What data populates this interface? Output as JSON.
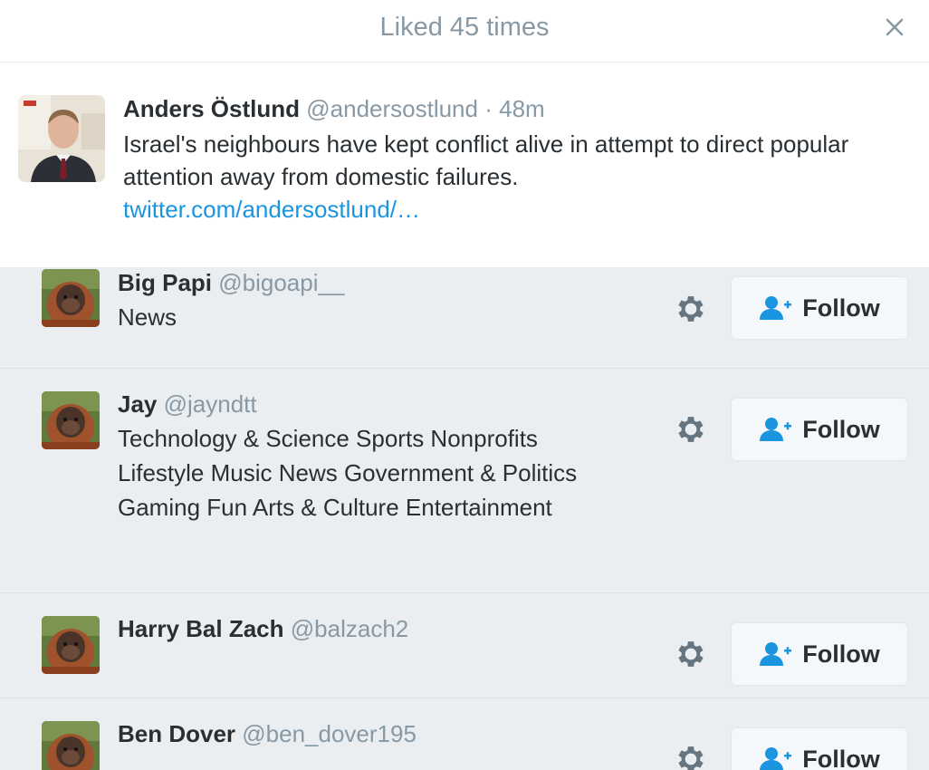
{
  "modal": {
    "title": "Liked 45 times"
  },
  "tweet": {
    "name": "Anders Östlund",
    "handle": "@andersostlund",
    "separator": "·",
    "time": "48m",
    "text": "Israel's neighbours have kept conflict alive in attempt to direct popular attention away from domestic failures.",
    "link": "twitter.com/andersostlund/…"
  },
  "likers": [
    {
      "name": "Big Papi",
      "handle": "@bigoapi__",
      "bio": "News",
      "follow_label": "Follow"
    },
    {
      "name": "Jay",
      "handle": "@jayndtt",
      "bio": "Technology & Science Sports Nonprofits Lifestyle Music News Government & Politics Gaming Fun Arts & Culture Entertainment",
      "follow_label": "Follow"
    },
    {
      "name": "Harry Bal Zach",
      "handle": "@balzach2",
      "bio": "",
      "follow_label": "Follow"
    },
    {
      "name": "Ben Dover",
      "handle": "@ben_dover195",
      "bio": "",
      "follow_label": "Follow"
    }
  ],
  "icons": {
    "close": "close-icon",
    "settings": "gear-icon",
    "follow": "add-user-icon"
  },
  "colors": {
    "accent": "#1b95e0",
    "muted": "#8899a6",
    "list_background": "#eaeef1"
  }
}
